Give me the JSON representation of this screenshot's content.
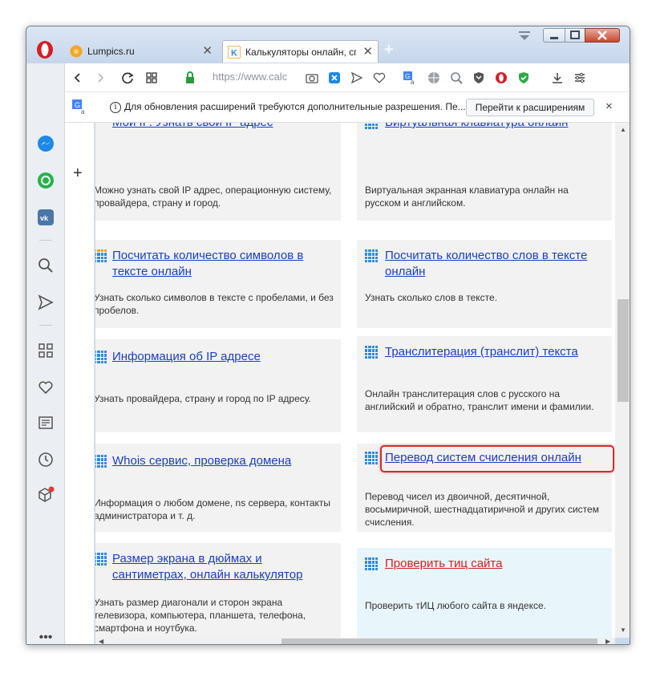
{
  "tabs": [
    {
      "label": "Lumpics.ru",
      "icon": "lumpics-favicon"
    },
    {
      "label": "Калькуляторы онлайн, спр",
      "icon": "calc-favicon"
    }
  ],
  "toolbar": {
    "url": "https://www.calc"
  },
  "notification": {
    "text": "Для обновления расширений требуются дополнительные разрешения. Пе...",
    "button": "Перейти к расширениям",
    "close": "×"
  },
  "cards": [
    {
      "title": "Мои IP. Узнать свой IP адрес",
      "desc": "Можно узнать свой IP адрес, операционную систему, провайдера, страну и город."
    },
    {
      "title": "Виртуальная клавиатура онлайн",
      "desc": "Виртуальная экранная клавиатура онлайн на русском и английском."
    },
    {
      "title": "Посчитать количество символов в тексте онлайн",
      "desc": "Узнать сколько символов в тексте с пробелами, и без пробелов."
    },
    {
      "title": "Посчитать количество слов в тексте онлайн",
      "desc": "Узнать сколько слов в тексте."
    },
    {
      "title": "Информация об IP адресе",
      "desc": "Узнать провайдера, страну и город по IP адресу."
    },
    {
      "title": "Транслитерация (транслит) текста",
      "desc": "Онлайн транслитерация слов с русского на английский и обратно, транслит имени и фамилии."
    },
    {
      "title": "Whois сервис, проверка домена",
      "desc": "Информация о любом домене, ns сервера, контакты администратора и т. д."
    },
    {
      "title": "Перевод систем счисления онлайн",
      "desc": "Перевод чисел из двоичной, десятичной, восьмиричной, шестнадцатиричной и других систем счисления."
    },
    {
      "title": "Размер экрана в дюймах и сантиметрах, онлайн калькулятор",
      "desc": "Узнать размер диагонали и сторон экрана телевизора, компьютера, планшета, телефона, смартфона и ноутбука."
    },
    {
      "title": "Проверить тиц сайта",
      "desc": "Проверить тИЦ любого сайта в яндексе."
    }
  ],
  "colors": {
    "link": "#1a3ec2",
    "promo_link": "#d42020",
    "highlight_border": "#d62a2a",
    "opera_red": "#d51e26"
  }
}
